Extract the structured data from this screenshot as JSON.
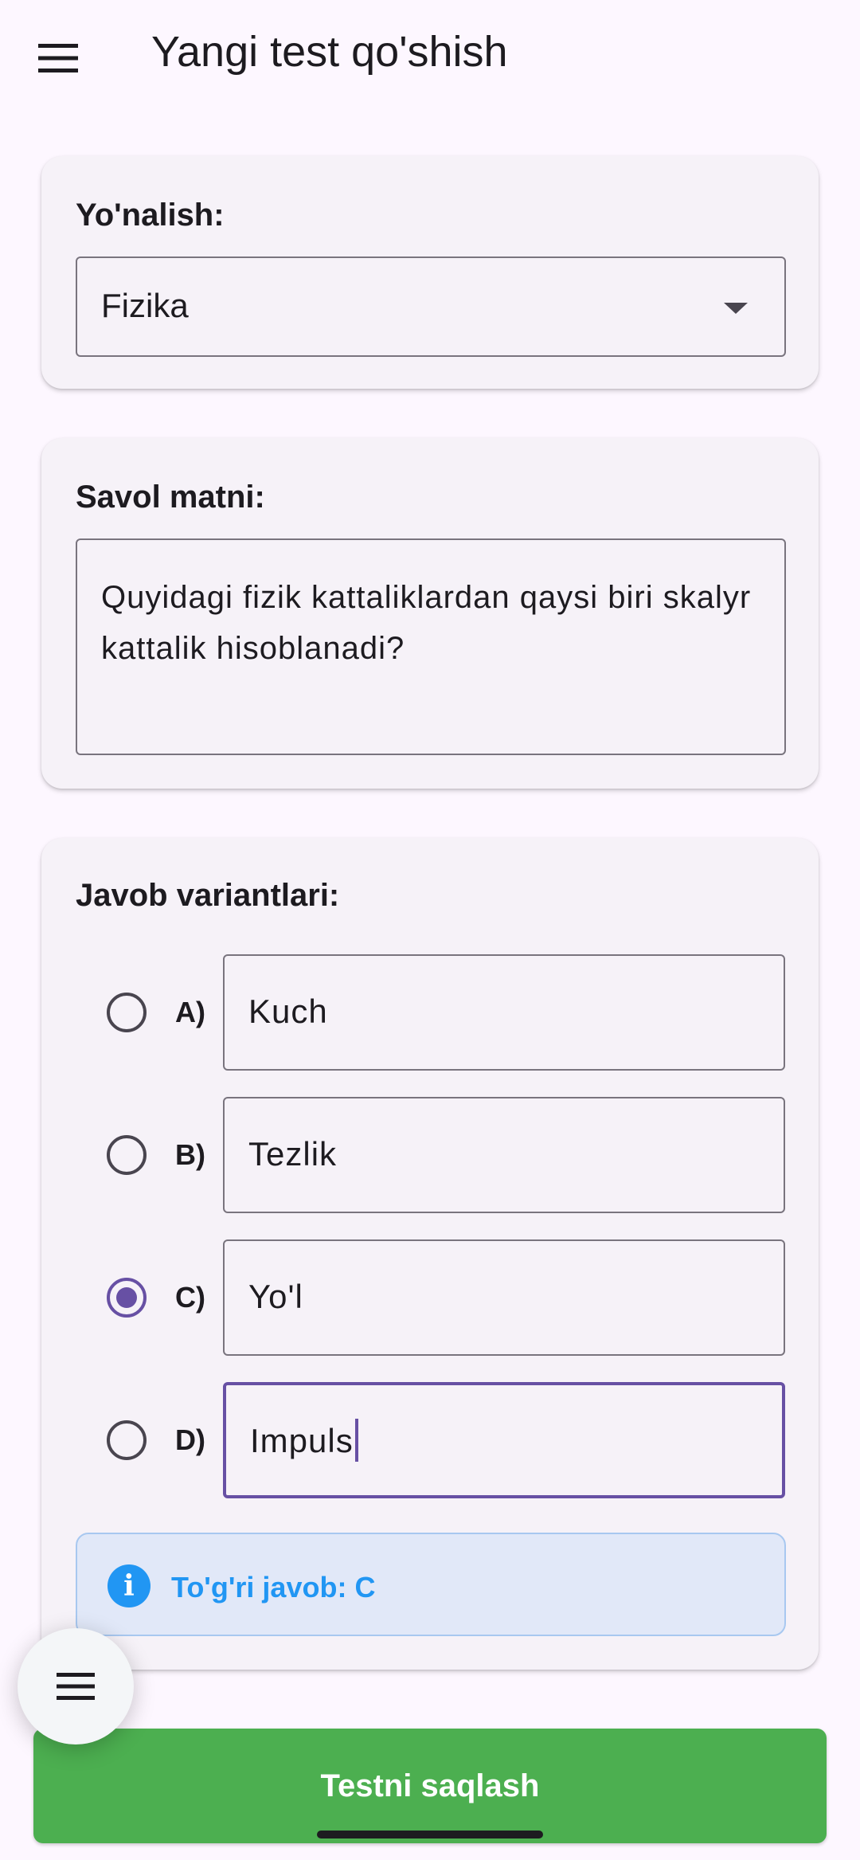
{
  "appbar": {
    "title": "Yangi test qo'shish",
    "menu_icon": "hamburger-menu-icon"
  },
  "direction_card": {
    "label": "Yo'nalish:",
    "selected_value": "Fizika"
  },
  "question_card": {
    "label": "Savol matni:",
    "value": "Quyidagi fizik kattaliklardan qaysi biri skalyr kattalik hisoblanadi?"
  },
  "answers_card": {
    "label": "Javob variantlari:",
    "options": [
      {
        "letter": "A)",
        "value": "Kuch",
        "selected": false
      },
      {
        "letter": "B)",
        "value": "Tezlik",
        "selected": false
      },
      {
        "letter": "C)",
        "value": "Yo'l",
        "selected": true
      },
      {
        "letter": "D)",
        "value": "Impuls",
        "selected": false
      }
    ],
    "info_icon": "info-icon",
    "correct_answer_text": "To'g'ri javob: C"
  },
  "fab": {
    "icon": "hamburger-menu-icon"
  },
  "save_button": {
    "label": "Testni saqlash"
  },
  "colors": {
    "accent": "#6750a4",
    "save": "#4caf50",
    "info": "#2196f3",
    "background": "#fdf7ff"
  }
}
